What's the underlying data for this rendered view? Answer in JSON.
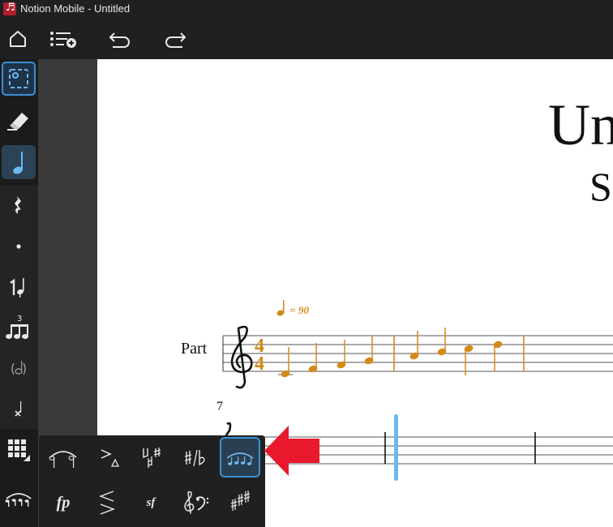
{
  "window": {
    "title": "Notion Mobile - Untitled",
    "app_icon": "notion-logo-icon"
  },
  "toolbar": {
    "items": [
      "home-icon",
      "add-instrument-icon",
      "undo-icon",
      "redo-icon"
    ]
  },
  "sidebar": {
    "tools": [
      {
        "name": "selection-tool",
        "icon": "selection-icon",
        "state": "selected"
      },
      {
        "name": "eraser-tool",
        "icon": "eraser-icon",
        "state": "normal"
      },
      {
        "name": "note-tool",
        "icon": "quarter-note-icon",
        "state": "active"
      }
    ],
    "modifiers": [
      "quarter-rest-icon",
      "dot-icon",
      "grace-note-icon",
      "triplet-icon",
      "cue-note-icon",
      "x-notehead-icon"
    ],
    "palette_toggle": "grid-icon",
    "current_palette": "slur-palette-icon"
  },
  "score": {
    "title": "Un",
    "subtitle": "S",
    "tempo_value": "= 90",
    "part_name": "Part",
    "time_signature": {
      "top": "4",
      "bottom": "4"
    },
    "measure_number": "7"
  },
  "palette": {
    "items": [
      {
        "name": "ties-slurs",
        "icon": "tie-slur-icon"
      },
      {
        "name": "articulations",
        "icon": "articulation-icon"
      },
      {
        "name": "accidentals",
        "icon": "natural-sharp-icon"
      },
      {
        "name": "sharp-flat",
        "icon": "sharp-flat-icon"
      },
      {
        "name": "slur-articulations",
        "icon": "slur-notes-icon",
        "selected": true
      },
      {
        "name": "dynamics",
        "icon": "fp-dynamic-icon",
        "label": "fp"
      },
      {
        "name": "hairpins",
        "icon": "hairpin-icon"
      },
      {
        "name": "sforzando",
        "icon": "sf-dynamic-icon",
        "label": "sf"
      },
      {
        "name": "clefs",
        "icon": "clef-icon"
      },
      {
        "name": "key-signatures",
        "icon": "key-signature-icon"
      }
    ]
  },
  "colors": {
    "accent_blue": "#3a8fd6",
    "note_orange": "#d48a1a",
    "cursor_blue": "#6bb8f0",
    "arrow_red": "#e8192c"
  }
}
